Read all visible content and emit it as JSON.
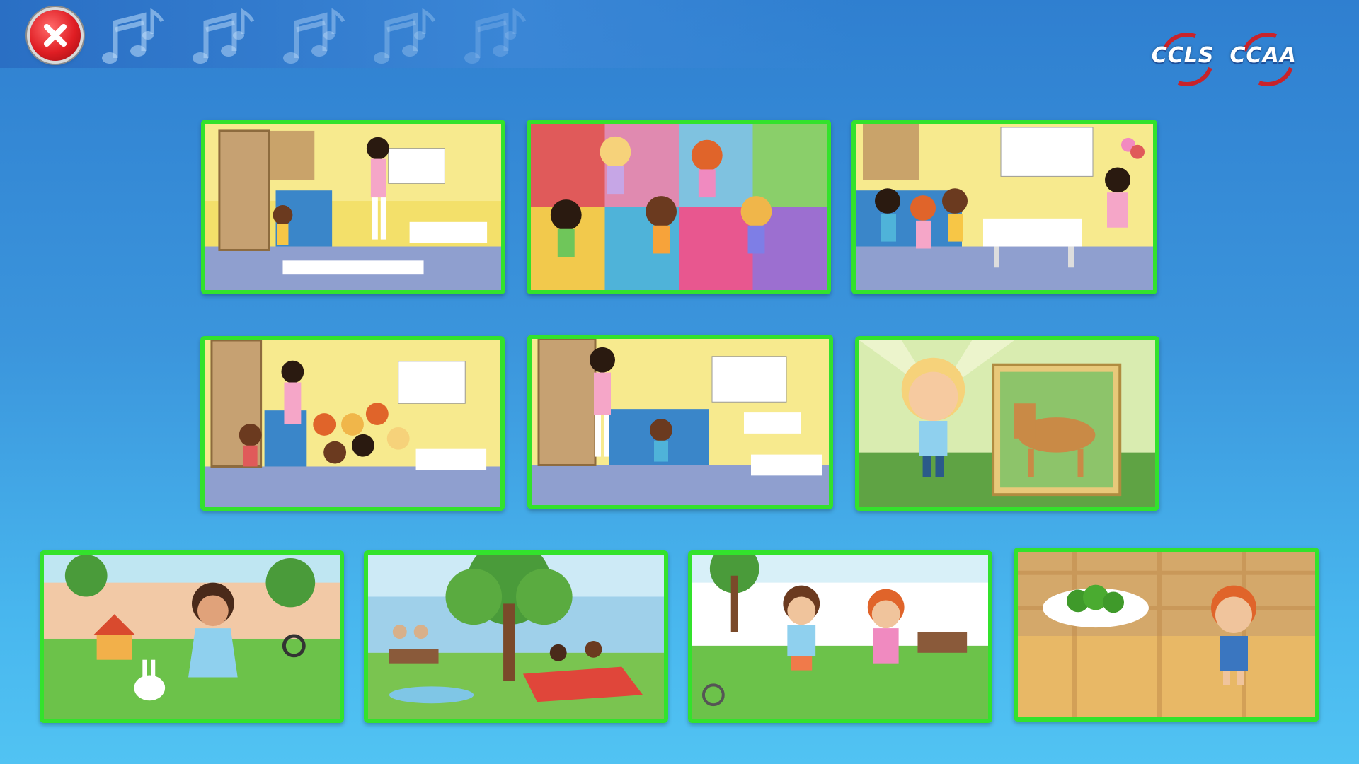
{
  "header": {
    "close_icon": "close-icon",
    "note_icon": "music-note-icon",
    "note_count": 5,
    "logos": [
      "CCLS",
      "CCAA"
    ]
  },
  "tiles": [
    {
      "scene": "classroom-teacher-boy-door"
    },
    {
      "scene": "kids-on-puzzle-mat"
    },
    {
      "scene": "classroom-art-table"
    },
    {
      "scene": "classroom-group-arrival"
    },
    {
      "scene": "classroom-teacher-boy"
    },
    {
      "scene": "boy-with-horse-picture"
    },
    {
      "scene": "backyard-girl-bunny"
    },
    {
      "scene": "park-picnic"
    },
    {
      "scene": "backyard-kids-waving"
    },
    {
      "scene": "girl-with-broccoli"
    }
  ],
  "colors": {
    "tile_border": "#33e22c",
    "close_button": "#e01e24",
    "logo_ring": "#c8232b"
  }
}
